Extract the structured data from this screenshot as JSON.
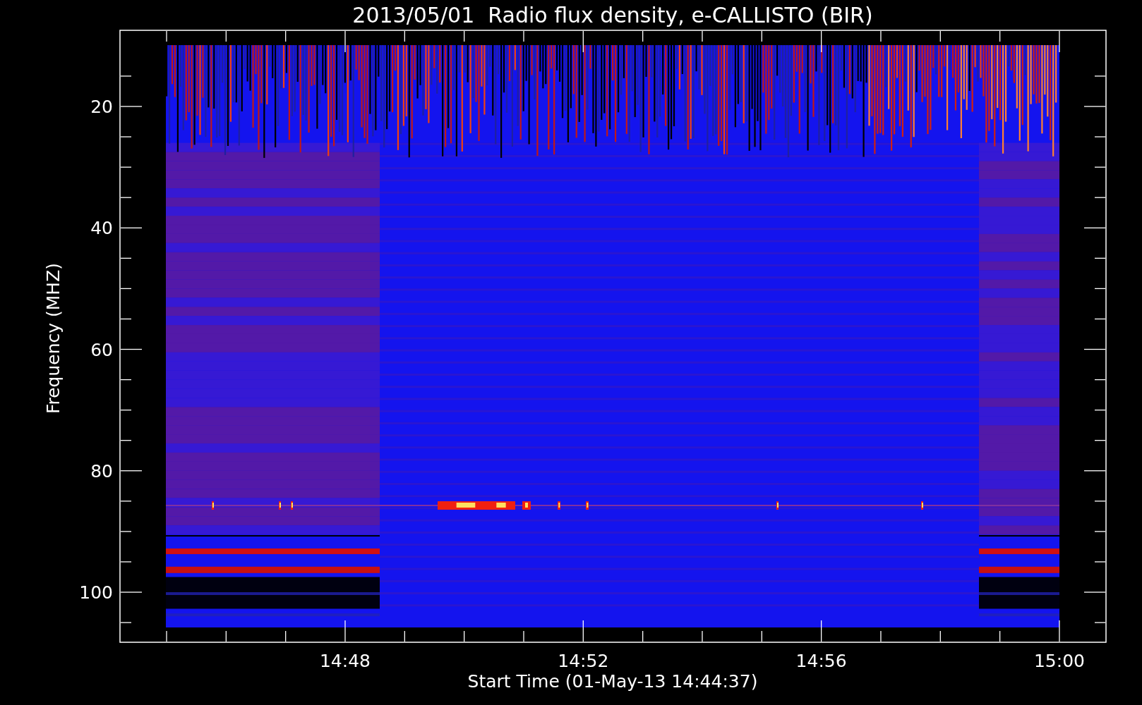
{
  "plot": {
    "title": "2013/05/01  Radio flux density, e-CALLISTO (BIR)",
    "ylabel": "Frequency (MHZ)",
    "xlabel": "Start Time (01-May-13 14:44:37)",
    "yticks": [
      "20",
      "40",
      "60",
      "80",
      "100"
    ],
    "xticks": [
      "14:48",
      "14:52",
      "14:56",
      "15:00"
    ]
  }
}
